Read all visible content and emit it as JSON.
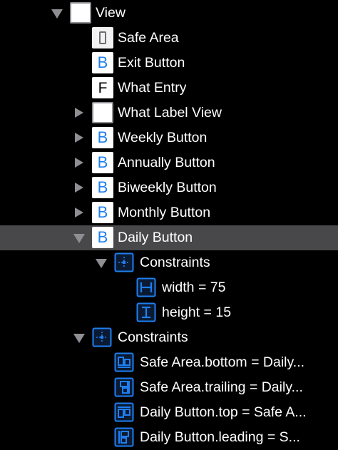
{
  "outline": {
    "rows": [
      {
        "label": "View",
        "disclosure": "expanded",
        "icon": "view-icon",
        "selected": false
      },
      {
        "label": "Safe Area",
        "disclosure": "none",
        "icon": "safe-area-icon",
        "selected": false
      },
      {
        "label": "Exit Button",
        "disclosure": "none",
        "icon": "button-icon",
        "selected": false
      },
      {
        "label": "What Entry",
        "disclosure": "none",
        "icon": "text-field-icon",
        "selected": false
      },
      {
        "label": "What Label View",
        "disclosure": "collapsed",
        "icon": "view-icon",
        "selected": false
      },
      {
        "label": "Weekly Button",
        "disclosure": "collapsed",
        "icon": "button-icon",
        "selected": false
      },
      {
        "label": "Annually Button",
        "disclosure": "collapsed",
        "icon": "button-icon",
        "selected": false
      },
      {
        "label": "Biweekly Button",
        "disclosure": "collapsed",
        "icon": "button-icon",
        "selected": false
      },
      {
        "label": "Monthly Button",
        "disclosure": "collapsed",
        "icon": "button-icon",
        "selected": false
      },
      {
        "label": "Daily Button",
        "disclosure": "expanded",
        "icon": "button-icon",
        "selected": true
      },
      {
        "label": "Constraints",
        "disclosure": "expanded",
        "icon": "constraints-icon",
        "selected": false
      },
      {
        "label": "width = 75",
        "disclosure": "none",
        "icon": "width-constraint-icon",
        "selected": false
      },
      {
        "label": "height = 15",
        "disclosure": "none",
        "icon": "height-constraint-icon",
        "selected": false
      },
      {
        "label": "Constraints",
        "disclosure": "expanded",
        "icon": "constraints-icon",
        "selected": false
      },
      {
        "label": "Safe Area.bottom = Daily...",
        "disclosure": "none",
        "icon": "bottom-constraint-icon",
        "selected": false
      },
      {
        "label": "Safe Area.trailing = Daily...",
        "disclosure": "none",
        "icon": "trailing-constraint-icon",
        "selected": false
      },
      {
        "label": "Daily Button.top = Safe A...",
        "disclosure": "none",
        "icon": "top-constraint-icon",
        "selected": false
      },
      {
        "label": "Daily Button.leading = S...",
        "disclosure": "none",
        "icon": "leading-constraint-icon",
        "selected": false
      }
    ]
  },
  "colors": {
    "background": "#000000",
    "selection": "#48484a",
    "text": "#ffffff",
    "accent_blue": "#1e7ff0",
    "disclosure": "#8e8e93"
  }
}
